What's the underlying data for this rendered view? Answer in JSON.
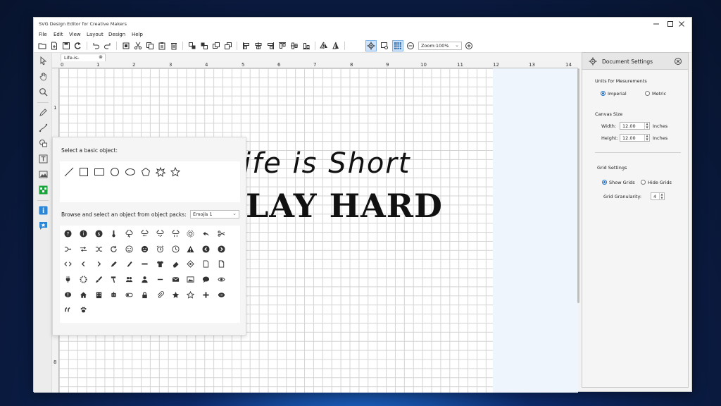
{
  "window": {
    "title": "SVG Design Editor for Creative Makers"
  },
  "menu": [
    "File",
    "Edit",
    "View",
    "Layout",
    "Design",
    "Help"
  ],
  "toolbar": {
    "zoom": "Zoom:100%"
  },
  "document": {
    "tab_label": "Life-is-",
    "close_glyph": "⊗"
  },
  "ruler": {
    "top": [
      "0",
      "1",
      "2",
      "3",
      "4",
      "5",
      "6",
      "7",
      "8",
      "9",
      "10",
      "11",
      "12",
      "13",
      "14"
    ],
    "left": [
      "1",
      "2",
      "3",
      "4",
      "5",
      "6",
      "7",
      "8"
    ]
  },
  "canvas": {
    "line1": "ife is Short",
    "line2": "LAY HARD"
  },
  "object_picker": {
    "basic_title": "Select a basic object:",
    "pack_title": "Browse and select an object from object packs:",
    "pack_selected": "Emojis 1",
    "basic_shapes": [
      "line-icon",
      "square-icon",
      "rectangle-icon",
      "circle-icon",
      "ellipse-icon",
      "pentagon-icon",
      "burst-star-icon",
      "star-icon"
    ]
  },
  "settings": {
    "title": "Document Settings",
    "units_label": "Units for Mesurements",
    "unit_imperial": "Imperial",
    "unit_metric": "Metric",
    "unit_selected": "Imperial",
    "canvas_size_label": "Canvas Size",
    "width_label": "Width:",
    "width_value": "12.00",
    "width_unit": "Inches",
    "height_label": "Height:",
    "height_value": "12.00",
    "height_unit": "Inches",
    "grid_label": "Grid Settings",
    "show_grids": "Show Grids",
    "hide_grids": "Hide Grids",
    "grid_selected": "Show Grids",
    "granularity_label": "Grid Granularity:",
    "granularity_value": "4"
  }
}
